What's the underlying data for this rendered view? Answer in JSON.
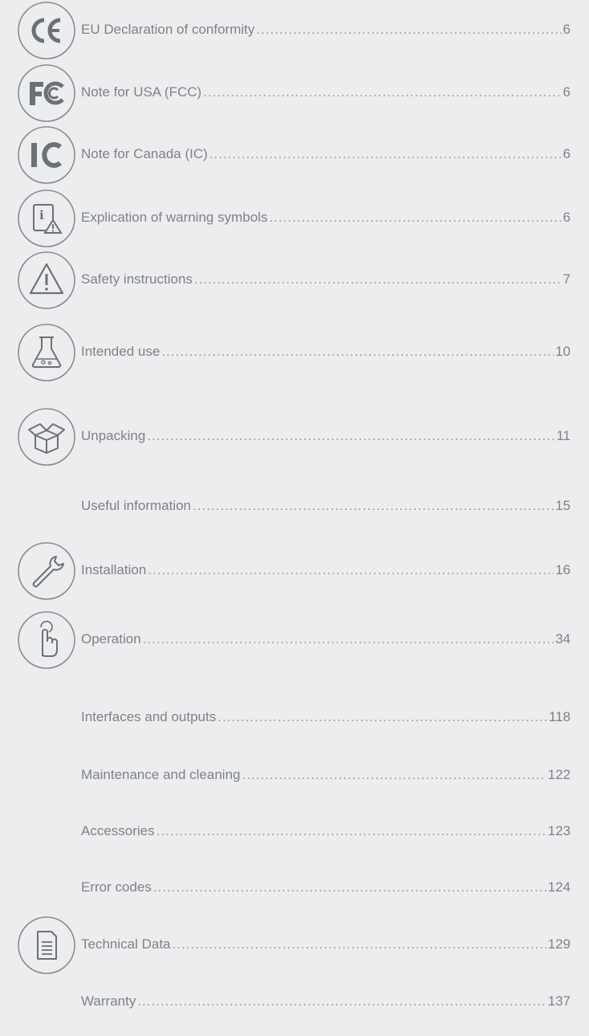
{
  "toc": {
    "entries": [
      {
        "icon": "ce-mark-icon",
        "label": "EU Declaration of conformity",
        "page": "6"
      },
      {
        "icon": "fcc-logo-icon",
        "label": "Note for USA (FCC)",
        "page": "6"
      },
      {
        "icon": "ic-logo-icon",
        "label": "Note for Canada (IC)",
        "page": "6"
      },
      {
        "icon": "info-warning-icon",
        "label": "Explication of warning symbols",
        "page": "6"
      },
      {
        "icon": "warning-triangle-icon",
        "label": "Safety instructions",
        "page": "7"
      },
      {
        "icon": "flask-icon",
        "label": "Intended use",
        "page": "10"
      },
      {
        "icon": "open-box-icon",
        "label": "Unpacking",
        "page": "11"
      },
      {
        "icon": "",
        "label": "Useful information",
        "page": "15"
      },
      {
        "icon": "wrench-icon",
        "label": "Installation",
        "page": "16"
      },
      {
        "icon": "hand-touch-icon",
        "label": "Operation",
        "page": "34"
      },
      {
        "icon": "",
        "label": "Interfaces and outputs",
        "page": "118"
      },
      {
        "icon": "",
        "label": "Maintenance and cleaning",
        "page": "122"
      },
      {
        "icon": "",
        "label": "Accessories",
        "page": "123"
      },
      {
        "icon": "",
        "label": "Error codes",
        "page": "124"
      },
      {
        "icon": "document-icon",
        "label": "Technical Data",
        "page": "129"
      },
      {
        "icon": "",
        "label": "Warranty",
        "page": "137"
      }
    ]
  }
}
